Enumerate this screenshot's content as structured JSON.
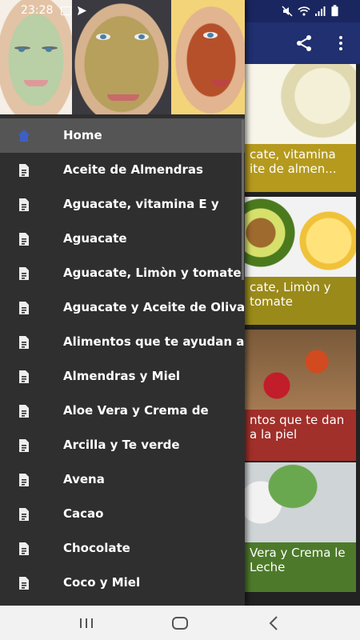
{
  "status_bar": {
    "time": "23:28"
  },
  "drawer": {
    "menu_items": [
      {
        "label": "Home",
        "icon": "home-icon",
        "active": true
      },
      {
        "label": "Aceite de Almendras",
        "icon": "document-icon"
      },
      {
        "label": "Aguacate, vitamina E y",
        "icon": "document-icon"
      },
      {
        "label": "Aguacate",
        "icon": "document-icon"
      },
      {
        "label": "Aguacate, Limòn y tomate",
        "icon": "document-icon"
      },
      {
        "label": "Aguacate y Aceite de Oliva",
        "icon": "document-icon"
      },
      {
        "label": "Alimentos que te ayudan a",
        "icon": "document-icon"
      },
      {
        "label": "Almendras y Miel",
        "icon": "document-icon"
      },
      {
        "label": "Aloe Vera y Crema de",
        "icon": "document-icon"
      },
      {
        "label": "Arcilla y Te verde",
        "icon": "document-icon"
      },
      {
        "label": "Avena",
        "icon": "document-icon"
      },
      {
        "label": "Cacao",
        "icon": "document-icon"
      },
      {
        "label": "Chocolate",
        "icon": "document-icon"
      },
      {
        "label": "Coco y Miel",
        "icon": "document-icon"
      }
    ]
  },
  "cards": [
    {
      "caption": "cate, vitamina ite de almen..."
    },
    {
      "caption": "cate, Limòn y tomate"
    },
    {
      "caption": "ntos que te dan a la piel"
    },
    {
      "caption": "Vera y Crema le Leche"
    }
  ],
  "colors": {
    "app_bar": "#203070",
    "drawer_bg": "#2f2f2f",
    "active_item": "#555555",
    "home_icon": "#3f5fc6"
  }
}
